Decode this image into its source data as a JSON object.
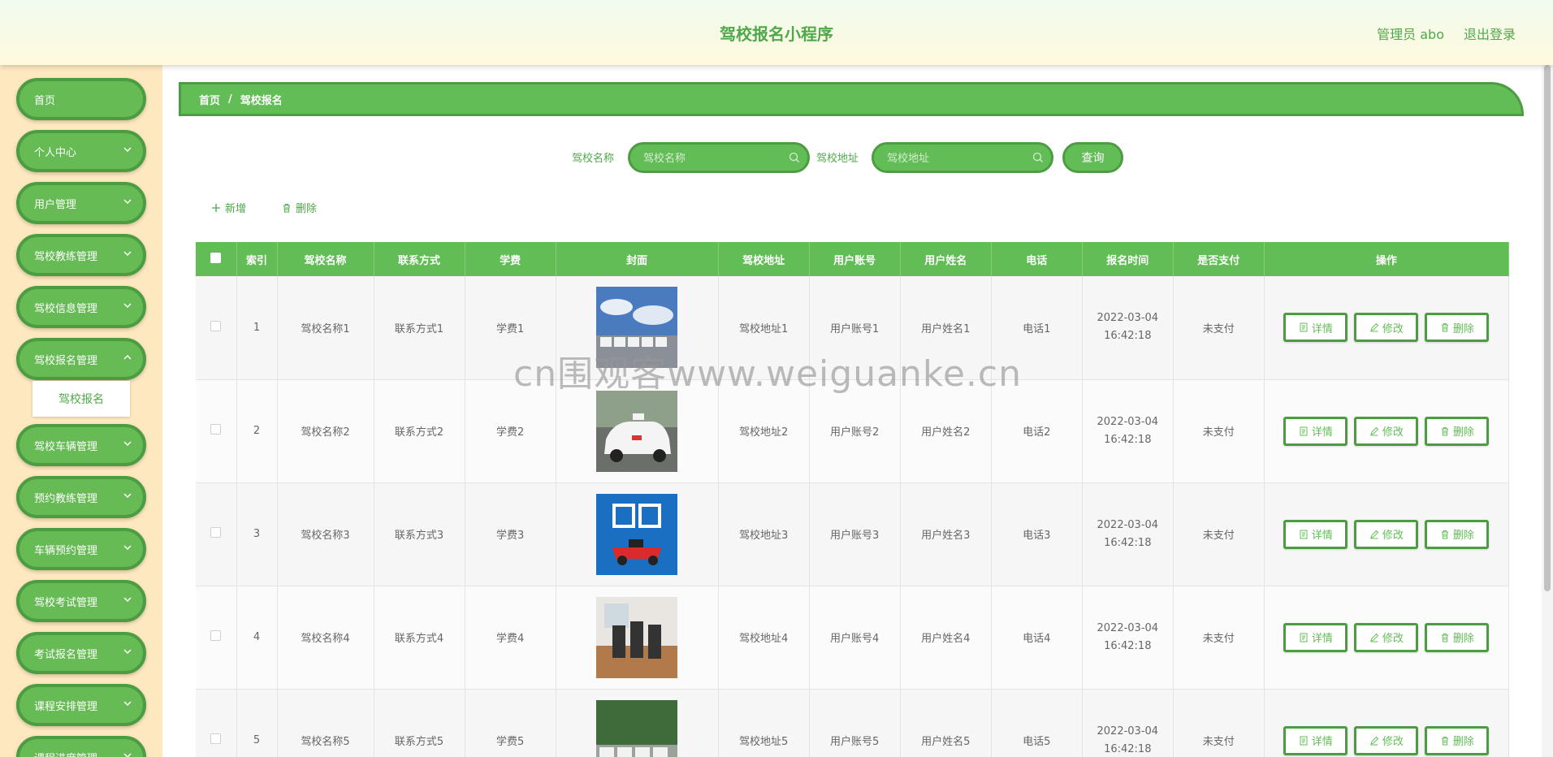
{
  "header": {
    "title": "驾校报名小程序",
    "admin_label": "管理员 abo",
    "logout_label": "退出登录"
  },
  "sidebar": {
    "items": [
      {
        "label": "首页",
        "has_arrow": false
      },
      {
        "label": "个人中心",
        "has_arrow": true
      },
      {
        "label": "用户管理",
        "has_arrow": true
      },
      {
        "label": "驾校教练管理",
        "has_arrow": true
      },
      {
        "label": "驾校信息管理",
        "has_arrow": true
      },
      {
        "label": "驾校报名管理",
        "has_arrow": true
      },
      {
        "label": "驾校车辆管理",
        "has_arrow": true
      },
      {
        "label": "预约教练管理",
        "has_arrow": true
      },
      {
        "label": "车辆预约管理",
        "has_arrow": true
      },
      {
        "label": "驾校考试管理",
        "has_arrow": true
      },
      {
        "label": "考试报名管理",
        "has_arrow": true
      },
      {
        "label": "课程安排管理",
        "has_arrow": true
      },
      {
        "label": "课程进度管理",
        "has_arrow": true
      }
    ],
    "submenu": {
      "label": "驾校报名"
    }
  },
  "breadcrumb": {
    "home": "首页",
    "separator": "/",
    "current": "驾校报名"
  },
  "search": {
    "name_label": "驾校名称",
    "name_placeholder": "驾校名称",
    "address_label": "驾校地址",
    "address_placeholder": "驾校地址",
    "query_label": "查询"
  },
  "actions": {
    "add_label": "新增",
    "delete_label": "删除"
  },
  "table": {
    "columns": [
      "索引",
      "驾校名称",
      "联系方式",
      "学费",
      "封面",
      "驾校地址",
      "用户账号",
      "用户姓名",
      "电话",
      "报名时间",
      "是否支付",
      "操作"
    ],
    "rows": [
      {
        "index": "1",
        "name": "驾校名称1",
        "contact": "联系方式1",
        "fee": "学费1",
        "address": "驾校地址1",
        "account": "用户账号1",
        "username": "用户姓名1",
        "phone": "电话1",
        "time": "2022-03-04 16:42:18",
        "paid": "未支付"
      },
      {
        "index": "2",
        "name": "驾校名称2",
        "contact": "联系方式2",
        "fee": "学费2",
        "address": "驾校地址2",
        "account": "用户账号2",
        "username": "用户姓名2",
        "phone": "电话2",
        "time": "2022-03-04 16:42:18",
        "paid": "未支付"
      },
      {
        "index": "3",
        "name": "驾校名称3",
        "contact": "联系方式3",
        "fee": "学费3",
        "address": "驾校地址3",
        "account": "用户账号3",
        "username": "用户姓名3",
        "phone": "电话3",
        "time": "2022-03-04 16:42:18",
        "paid": "未支付"
      },
      {
        "index": "4",
        "name": "驾校名称4",
        "contact": "联系方式4",
        "fee": "学费4",
        "address": "驾校地址4",
        "account": "用户账号4",
        "username": "用户姓名4",
        "phone": "电话4",
        "time": "2022-03-04 16:42:18",
        "paid": "未支付"
      },
      {
        "index": "5",
        "name": "驾校名称5",
        "contact": "联系方式5",
        "fee": "学费5",
        "address": "驾校地址5",
        "account": "用户账号5",
        "username": "用户姓名5",
        "phone": "电话5",
        "time": "2022-03-04 16:42:18",
        "paid": "未支付"
      }
    ],
    "ops": {
      "detail": "详情",
      "edit": "修改",
      "delete": "删除"
    }
  },
  "watermark": "cn围观客www.weiguanke.cn",
  "colors": {
    "primary": "#63bd57",
    "primary_dark": "#4c9c41",
    "sidebar_bg": "#fde8c0",
    "text_green": "#4fa84b"
  }
}
